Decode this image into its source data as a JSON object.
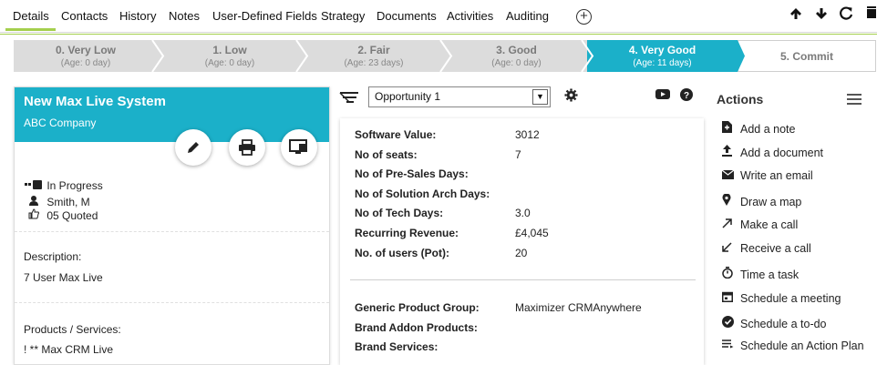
{
  "tabs": [
    {
      "label": "Details"
    },
    {
      "label": "Contacts"
    },
    {
      "label": "History"
    },
    {
      "label": "Notes"
    },
    {
      "label": "User-Defined Fields"
    },
    {
      "label": "Strategy"
    },
    {
      "label": "Documents"
    },
    {
      "label": "Activities"
    },
    {
      "label": "Auditing"
    }
  ],
  "accent_color": "#1bb0c9",
  "tab_underline_color": "#a4cf4d",
  "pipeline": [
    {
      "name": "0. Very Low",
      "age": "(Age: 0 day)"
    },
    {
      "name": "1. Low",
      "age": "(Age: 0 day)"
    },
    {
      "name": "2. Fair",
      "age": "(Age: 23 days)"
    },
    {
      "name": "3. Good",
      "age": "(Age: 0 day)"
    },
    {
      "name": "4. Very Good",
      "age": "(Age: 11 days)"
    },
    {
      "name": "5. Commit",
      "age": ""
    }
  ],
  "card": {
    "title": "New Max Live System",
    "company": "ABC Company",
    "status": "In Progress",
    "owner": "Smith, M",
    "rating": "05 Quoted",
    "description_label": "Description:",
    "description": "7 User Max Live",
    "products_label": "Products / Services:",
    "products": "! ** Max CRM Live"
  },
  "opportunity_select": {
    "value": "Opportunity 1"
  },
  "fields": [
    {
      "label": "Software Value:",
      "value": "3012"
    },
    {
      "label": "No of seats:",
      "value": "7"
    },
    {
      "label": "No of Pre-Sales Days:",
      "value": ""
    },
    {
      "label": "No of Solution Arch Days:",
      "value": ""
    },
    {
      "label": "No of Tech Days:",
      "value": "3.0"
    },
    {
      "label": "Recurring Revenue:",
      "value": "£4,045"
    },
    {
      "label": "No. of users (Pot):",
      "value": "20"
    }
  ],
  "fields2": [
    {
      "label": "Generic Product Group:",
      "value": "Maximizer CRMAnywhere"
    },
    {
      "label": "Brand Addon Products:",
      "value": ""
    },
    {
      "label": "Brand Services:",
      "value": ""
    }
  ],
  "actions": {
    "title": "Actions",
    "items": [
      {
        "label": "Add a note",
        "icon": "note-icon"
      },
      {
        "label": "Add a document",
        "icon": "upload-icon"
      },
      {
        "label": "Write an email",
        "icon": "envelope-icon"
      },
      {
        "label": "Draw a map",
        "icon": "map-pin-icon"
      },
      {
        "label": "Make a call",
        "icon": "outgoing-call-icon"
      },
      {
        "label": "Receive a call",
        "icon": "incoming-call-icon"
      },
      {
        "label": "Time a task",
        "icon": "stopwatch-icon"
      },
      {
        "label": "Schedule a meeting",
        "icon": "calendar-icon"
      },
      {
        "label": "Schedule a to-do",
        "icon": "check-circle-icon"
      },
      {
        "label": "Schedule an Action Plan",
        "icon": "list-icon"
      }
    ]
  }
}
